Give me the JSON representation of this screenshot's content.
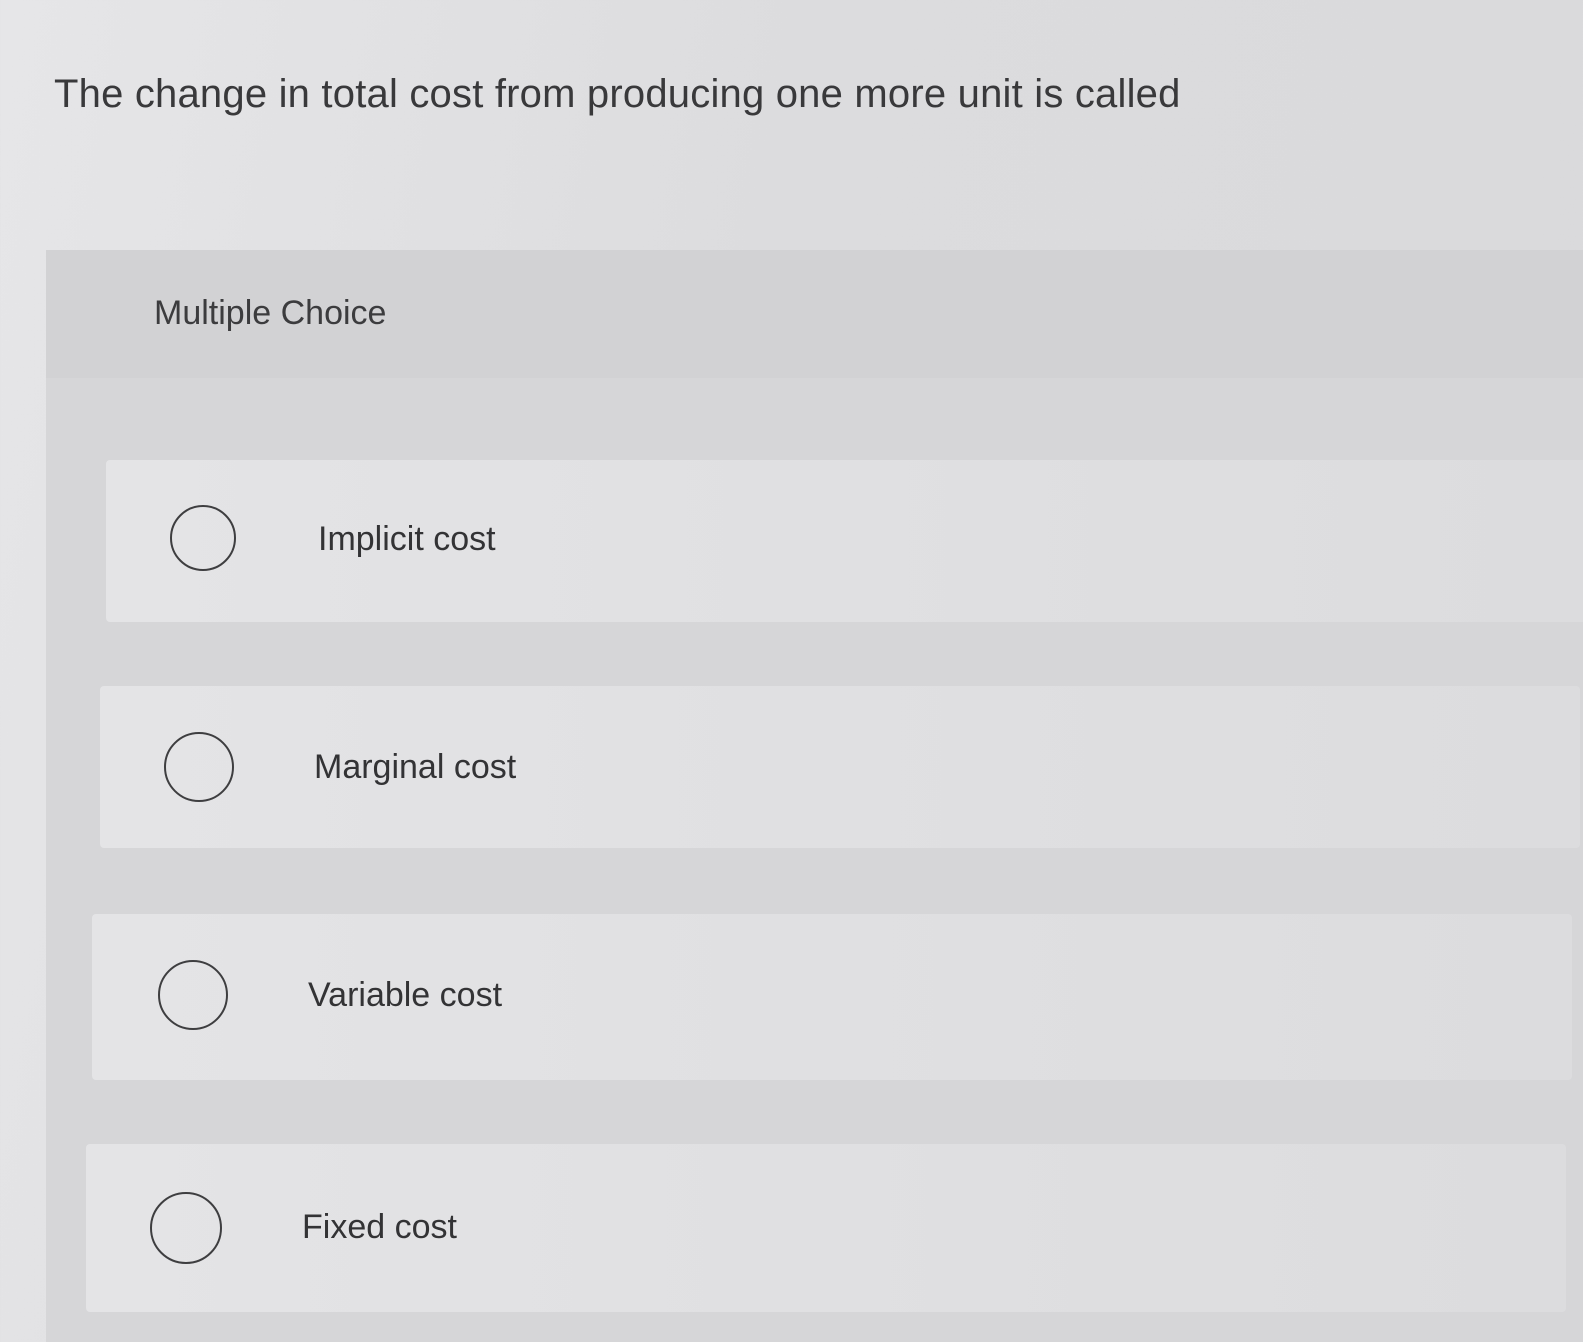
{
  "question": {
    "text": "The change in total cost from producing one more unit is called"
  },
  "multiple_choice": {
    "label": "Multiple Choice",
    "options": [
      {
        "label": "Implicit cost"
      },
      {
        "label": "Marginal cost"
      },
      {
        "label": "Variable cost"
      },
      {
        "label": "Fixed cost"
      }
    ]
  }
}
